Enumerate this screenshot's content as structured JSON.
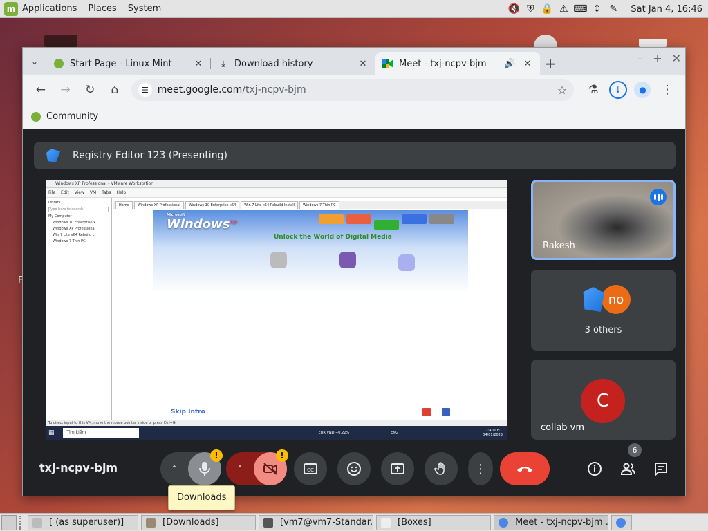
{
  "top_panel": {
    "menus": [
      "Applications",
      "Places",
      "System"
    ],
    "clock": "Sat Jan  4, 16:46"
  },
  "browser": {
    "tabs": [
      {
        "label": "Start Page - Linux Mint",
        "icon": "linux-mint-icon"
      },
      {
        "label": "Download history",
        "icon": "download-icon"
      },
      {
        "label": "Meet - txj-ncpv-bjm",
        "icon": "google-meet-icon",
        "audio": true
      }
    ],
    "new_tab": "+",
    "url_host": "meet.google.com",
    "url_path": "/txj-ncpv-bjm",
    "bookmarks": [
      {
        "label": "Community"
      }
    ]
  },
  "meet": {
    "presenting_label": "Registry Editor 123 (Presenting)",
    "meeting_code": "txj-ncpv-bjm",
    "participants": [
      {
        "name": "Rakesh",
        "speaking": true
      },
      {
        "name": "3 others",
        "avatar_text": "no"
      },
      {
        "name": "collab vm",
        "avatar_text": "C"
      }
    ],
    "people_count": "6",
    "warning_badge": "!",
    "tooltip": "Downloads"
  },
  "vm_screen": {
    "window_title": "Windows XP Professional - VMware Workstation",
    "menu": [
      "File",
      "Edit",
      "View",
      "VM",
      "Tabs",
      "Help"
    ],
    "library_label": "Library",
    "library_search": "Type here to search",
    "library_items": [
      "My Computer",
      "Windows 10 Enterprise x",
      "Windows XP Professional",
      "Win 7 Lite x64 Rebuild L",
      "Windows 7 Thin PC"
    ],
    "vm_tabs": [
      "Home",
      "Windows XP Professional",
      "Windows 10 Enterprise x64",
      "Win 7 Lite x64 Rebuild Install",
      "Windows 7 Thin PC"
    ],
    "xp_logo_small": "Microsoft",
    "xp_logo": "Windows",
    "xp_logo_suffix": "xp",
    "tagline": "Unlock the World of Digital Media",
    "skip_intro": "Skip Intro",
    "status": "To direct input to this VM, move the mouse pointer inside or press Ctrl+G.",
    "taskbar_search": "Tìm kiếm",
    "taskbar_weather": "EUR/VND +0.22%",
    "taskbar_lang": "ENG",
    "taskbar_time": "2:40 CH",
    "taskbar_date": "04/01/2023"
  },
  "desktop": {
    "edge_text": "F"
  },
  "bottom_panel": {
    "tasks": [
      "[ (as superuser)]",
      "[Downloads]",
      "[vm7@vm7-Standar...",
      "[Boxes]",
      "Meet - txj-ncpv-bjm ..."
    ]
  }
}
